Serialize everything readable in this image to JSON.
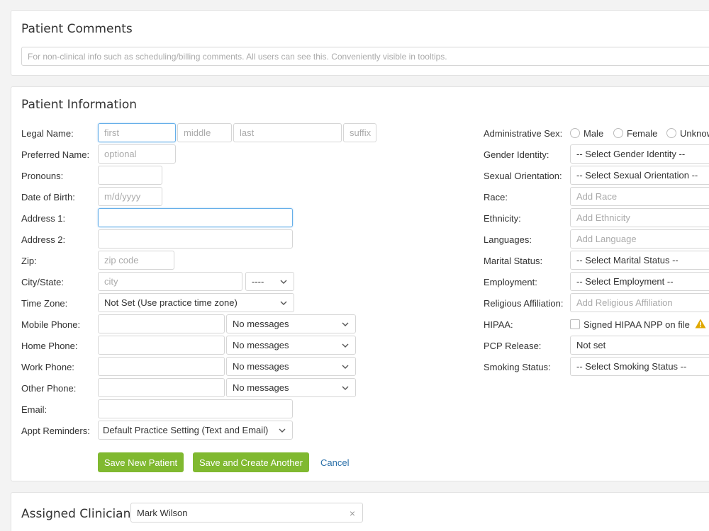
{
  "comments": {
    "title": "Patient Comments",
    "placeholder": "For non-clinical info such as scheduling/billing comments. All users can see this. Conveniently visible in tooltips."
  },
  "info": {
    "title": "Patient Information",
    "legal_name": {
      "label": "Legal Name:",
      "first_ph": "first",
      "middle_ph": "middle",
      "last_ph": "last",
      "suffix_ph": "suffix"
    },
    "preferred_name": {
      "label": "Preferred Name:",
      "ph": "optional"
    },
    "pronouns": {
      "label": "Pronouns:"
    },
    "dob": {
      "label": "Date of Birth:",
      "ph": "m/d/yyyy"
    },
    "address1": {
      "label": "Address 1:"
    },
    "address2": {
      "label": "Address 2:"
    },
    "zip": {
      "label": "Zip:",
      "ph": "zip code"
    },
    "city_state": {
      "label": "City/State:",
      "city_ph": "city",
      "state_value": "----"
    },
    "time_zone": {
      "label": "Time Zone:",
      "value": "Not Set (Use practice time zone)"
    },
    "mobile_phone": {
      "label": "Mobile Phone:",
      "msg": "No messages"
    },
    "home_phone": {
      "label": "Home Phone:",
      "msg": "No messages"
    },
    "work_phone": {
      "label": "Work Phone:",
      "msg": "No messages"
    },
    "other_phone": {
      "label": "Other Phone:",
      "msg": "No messages"
    },
    "email": {
      "label": "Email:"
    },
    "appt_reminders": {
      "label": "Appt Reminders:",
      "value": "Default Practice Setting (Text and Email)"
    },
    "admin_sex": {
      "label": "Administrative Sex:",
      "male": "Male",
      "female": "Female",
      "unknown": "Unknow"
    },
    "gender_identity": {
      "label": "Gender Identity:",
      "value": "-- Select Gender Identity --"
    },
    "sexual_orientation": {
      "label": "Sexual Orientation:",
      "value": "-- Select Sexual Orientation --"
    },
    "race": {
      "label": "Race:",
      "ph": "Add Race"
    },
    "ethnicity": {
      "label": "Ethnicity:",
      "ph": "Add Ethnicity"
    },
    "languages": {
      "label": "Languages:",
      "ph": "Add Language"
    },
    "marital_status": {
      "label": "Marital Status:",
      "value": "-- Select Marital Status --"
    },
    "employment": {
      "label": "Employment:",
      "value": "-- Select Employment --"
    },
    "religious": {
      "label": "Religious Affiliation:",
      "ph": "Add Religious Affiliation"
    },
    "hipaa": {
      "label": "HIPAA:",
      "checkbox_label": "Signed HIPAA NPP on file",
      "icon": "warning-icon"
    },
    "pcp_release": {
      "label": "PCP Release:",
      "value": "Not set"
    },
    "smoking": {
      "label": "Smoking Status:",
      "value": "-- Select Smoking Status --"
    },
    "actions": {
      "save": "Save New Patient",
      "save_another": "Save and Create Another",
      "cancel": "Cancel"
    }
  },
  "clinician": {
    "label": "Assigned Clinician:",
    "value": "Mark Wilson",
    "clear": "×"
  },
  "colors": {
    "button": "#80b930",
    "link": "#2a6fa8",
    "focus": "#66afe9",
    "warning": "#e0a800"
  }
}
